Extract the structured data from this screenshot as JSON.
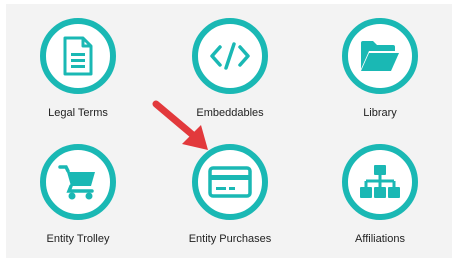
{
  "tiles": [
    {
      "label": "Legal Terms",
      "icon": "document-icon"
    },
    {
      "label": "Embeddables",
      "icon": "code-icon"
    },
    {
      "label": "Library",
      "icon": "folder-open-icon"
    },
    {
      "label": "Entity Trolley",
      "icon": "shopping-cart-icon"
    },
    {
      "label": "Entity Purchases",
      "icon": "credit-card-icon"
    },
    {
      "label": "Affiliations",
      "icon": "org-chart-icon"
    }
  ],
  "colors": {
    "accent": "#1ab8b4",
    "arrow": "#e2393c",
    "panel": "#f3f3f3"
  }
}
